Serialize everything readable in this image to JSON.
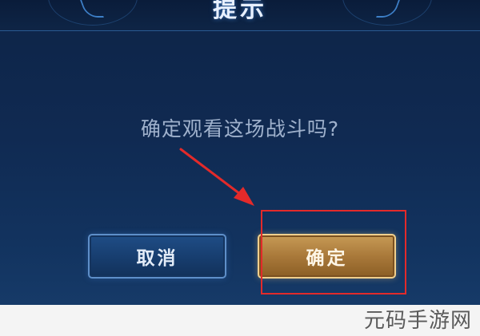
{
  "dialog": {
    "title": "提示",
    "message": "确定观看这场战斗吗?",
    "cancel_label": "取消",
    "confirm_label": "确定"
  },
  "watermark": "元码手游网",
  "colors": {
    "background": "#102a52",
    "cancel_button": "#1f4d86",
    "confirm_button": "#a9793a",
    "annotation": "#e32a2a"
  }
}
